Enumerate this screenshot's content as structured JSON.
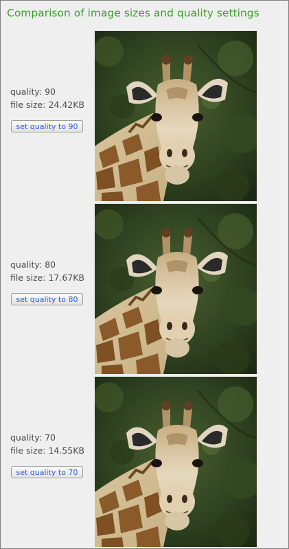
{
  "page": {
    "title": "Comparison of image sizes and quality settings"
  },
  "rows": [
    {
      "quality_label": "quality:",
      "quality": "90",
      "size_label": "file size:",
      "file_size": "24.42KB",
      "button_label": "set quality to 90"
    },
    {
      "quality_label": "quality:",
      "quality": "80",
      "size_label": "file size:",
      "file_size": "17.67KB",
      "button_label": "set quality to 80"
    },
    {
      "quality_label": "quality:",
      "quality": "70",
      "size_label": "file size:",
      "file_size": "14.55KB",
      "button_label": "set quality to 70"
    }
  ],
  "colors": {
    "title": "#3aa12a",
    "button_text": "#2d5fd8",
    "panel_bg": "#efefef"
  }
}
